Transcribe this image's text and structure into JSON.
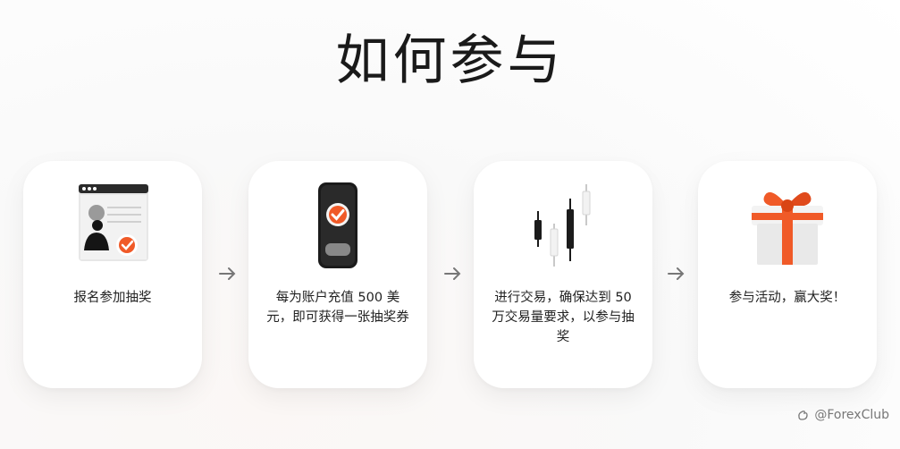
{
  "title": "如何参与",
  "steps": [
    {
      "text": "报名参加抽奖",
      "icon": "signup-form-icon"
    },
    {
      "text": "每为账户充值 500 美元，即可获得一张抽奖券",
      "icon": "phone-check-icon"
    },
    {
      "text": "进行交易，确保达到 50 万交易量要求，以参与抽奖",
      "icon": "candlestick-chart-icon"
    },
    {
      "text": "参与活动，赢大奖！",
      "icon": "gift-box-icon"
    }
  ],
  "watermark": "@ForexClub",
  "colors": {
    "accent": "#f05a28",
    "dark": "#1c1c1c",
    "card": "#ffffff"
  }
}
